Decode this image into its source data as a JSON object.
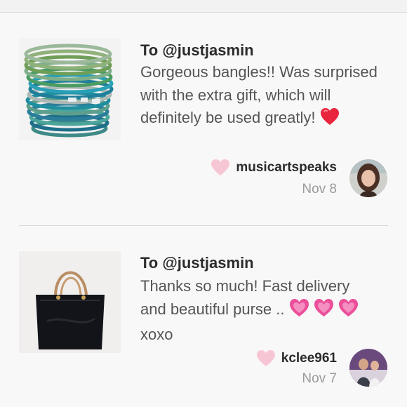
{
  "notes": [
    {
      "recipient": "To @justjasmin",
      "message": "Gorgeous bangles!! Was surprised with the extra gift, which will definitely be used greatly!",
      "message_emoji": "red-heart-icon",
      "username": "musicartspeaks",
      "date": "Nov 8",
      "thumbnail": "bangles-photo",
      "avatar": "user-avatar-photo"
    },
    {
      "recipient": "To @justjasmin",
      "message": "Thanks so much! Fast delivery and beautiful purse ..",
      "message_emoji": "sparkling-heart-icon",
      "message_tail": "xoxo",
      "username": "kclee961",
      "date": "Nov 7",
      "thumbnail": "black-purse-photo",
      "avatar": "user-avatar-photo"
    }
  ],
  "colors": {
    "like_heart": "#f7c6d4",
    "red_heart": "#e8253b",
    "pink_heart": "#ec4f9a",
    "divider": "#d8d6d8",
    "date": "#9a9a9a"
  }
}
